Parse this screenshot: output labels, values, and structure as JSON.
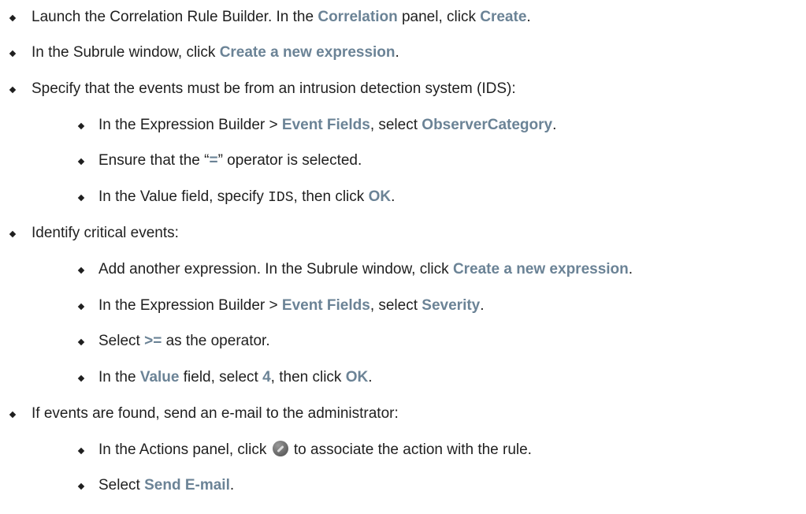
{
  "steps": [
    {
      "launch_text": "Launch the Correlation Rule Builder. In the ",
      "correlation_label": "Correlation",
      "panel_text": " panel, click ",
      "create_label": "Create",
      "end": "."
    },
    {
      "text": "In the Subrule window, click ",
      "create_expression_label": "Create a new expression",
      "end": "."
    },
    {
      "text": "Specify that the events must be from an intrusion detection system (IDS):",
      "substeps": [
        {
          "text": "In the Expression Builder > ",
          "event_fields_label": "Event Fields",
          "mid": ", select ",
          "field_label": "ObserverCategory",
          "end": "."
        },
        {
          "text": "Ensure that the “",
          "operator_label": "=",
          "end": "” operator is selected."
        },
        {
          "text": "In the Value field, specify ",
          "code": "IDS",
          "mid": ", then click ",
          "ok_label": "OK",
          "end": "."
        }
      ]
    },
    {
      "text": "Identify critical events:",
      "substeps": [
        {
          "text": "Add another expression. In the Subrule window, click ",
          "create_expression_label": "Create a new expression",
          "end": "."
        },
        {
          "text": "In the Expression Builder > ",
          "event_fields_label": "Event Fields",
          "mid": ", select ",
          "field_label": "Severity",
          "end": "."
        },
        {
          "text": "Select ",
          "operator_label": ">=",
          "end": " as the operator."
        },
        {
          "text": "In the ",
          "value_label": "Value",
          "mid": " field, select ",
          "value": "4",
          "mid2": ", then click ",
          "ok_label": "OK",
          "end": "."
        }
      ]
    },
    {
      "text": "If events are found, send an e-mail to the administrator:",
      "substeps": [
        {
          "text": "In the Actions panel, click ",
          "icon": "gear-icon",
          "end": " to associate the action with the rule."
        },
        {
          "text": "Select ",
          "send_email_label": "Send E-mail",
          "end": "."
        }
      ]
    }
  ]
}
